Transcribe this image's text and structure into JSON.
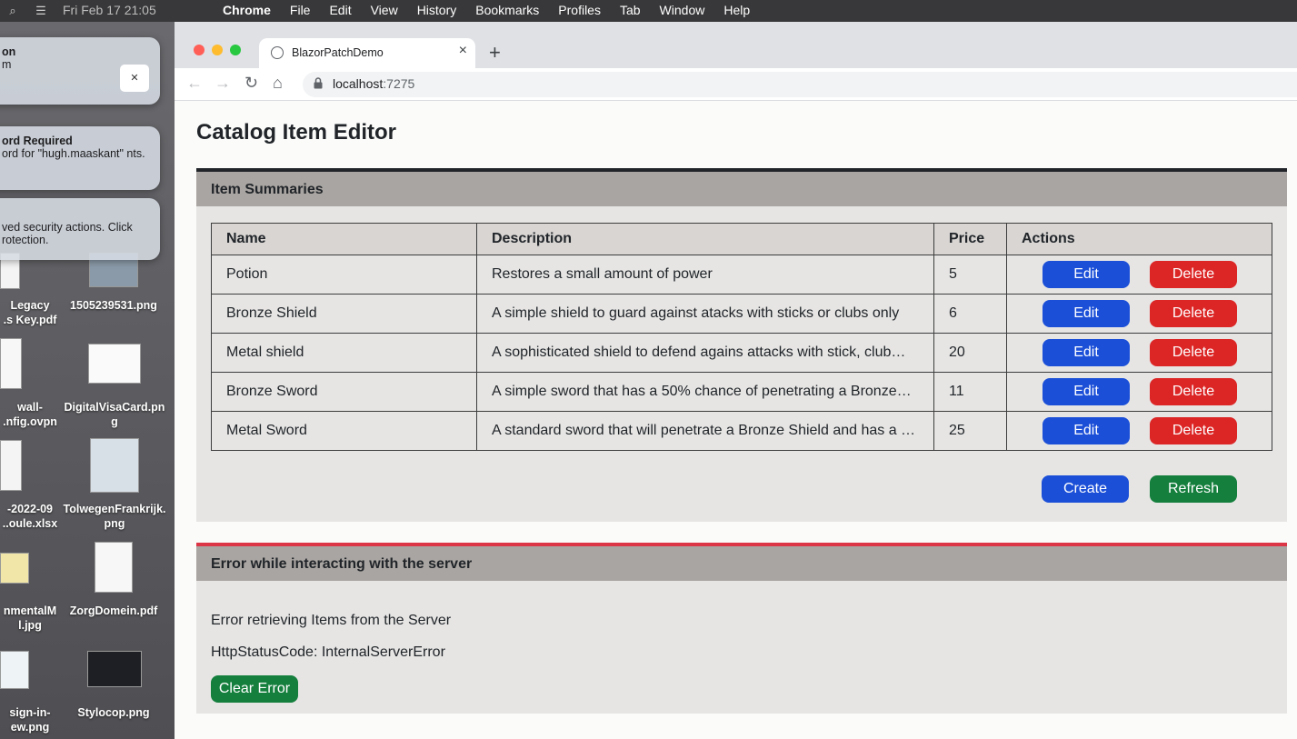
{
  "menubar": {
    "clock": "Fri Feb 17  21:05",
    "app_name": "Chrome",
    "menus": [
      "File",
      "Edit",
      "View",
      "History",
      "Bookmarks",
      "Profiles",
      "Tab",
      "Window",
      "Help"
    ]
  },
  "desktop": {
    "notifications": [
      {
        "title": "on",
        "body": "m"
      },
      {
        "title": "ord Required",
        "body": "ord for \"hugh.maaskant\" nts."
      },
      {
        "title": "",
        "body": "ved security actions. Click rotection."
      }
    ],
    "files": [
      {
        "line1": "Legacy",
        "line2": ".s Key.pdf"
      },
      {
        "line1": "1505239531.png",
        "line2": ""
      },
      {
        "line1": "wall-",
        "line2": ".nfig.ovpn"
      },
      {
        "line1": "DigitalVisaCard.pn",
        "line2": "g"
      },
      {
        "line1": "-2022-09",
        "line2": "..oule.xlsx"
      },
      {
        "line1": "TolwegenFrankrijk.",
        "line2": "png"
      },
      {
        "line1": "nmentalM",
        "line2": "l.jpg"
      },
      {
        "line1": "ZorgDomein.pdf",
        "line2": ""
      },
      {
        "line1": "sign-in-",
        "line2": "ew.png"
      },
      {
        "line1": "Stylocop.png",
        "line2": ""
      }
    ]
  },
  "browser": {
    "tab_title": "BlazorPatchDemo",
    "url_host": "localhost",
    "url_port": ":7275"
  },
  "page": {
    "title": "Catalog Item Editor",
    "summaries": {
      "header": "Item Summaries",
      "columns": {
        "name": "Name",
        "description": "Description",
        "price": "Price",
        "actions": "Actions"
      },
      "rows": [
        {
          "name": "Potion",
          "description": "Restores a small amount of power",
          "price": "5"
        },
        {
          "name": "Bronze Shield",
          "description": "A simple shield to guard against atacks with sticks or clubs only",
          "price": "6"
        },
        {
          "name": "Metal shield",
          "description": "A sophisticated shield to defend agains attacks with stick, club…",
          "price": "20"
        },
        {
          "name": "Bronze Sword",
          "description": "A simple sword that has a 50% chance of penetrating a Bronze…",
          "price": "11"
        },
        {
          "name": "Metal Sword",
          "description": "A standard sword that will penetrate a Bronze Shield and has a …",
          "price": "25"
        }
      ],
      "edit_label": "Edit",
      "delete_label": "Delete",
      "create_label": "Create",
      "refresh_label": "Refresh"
    },
    "error": {
      "header": "Error while interacting with the server",
      "message": "Error retrieving Items from the Server",
      "status": "HttpStatusCode: InternalServerError",
      "clear_label": "Clear Error"
    }
  }
}
